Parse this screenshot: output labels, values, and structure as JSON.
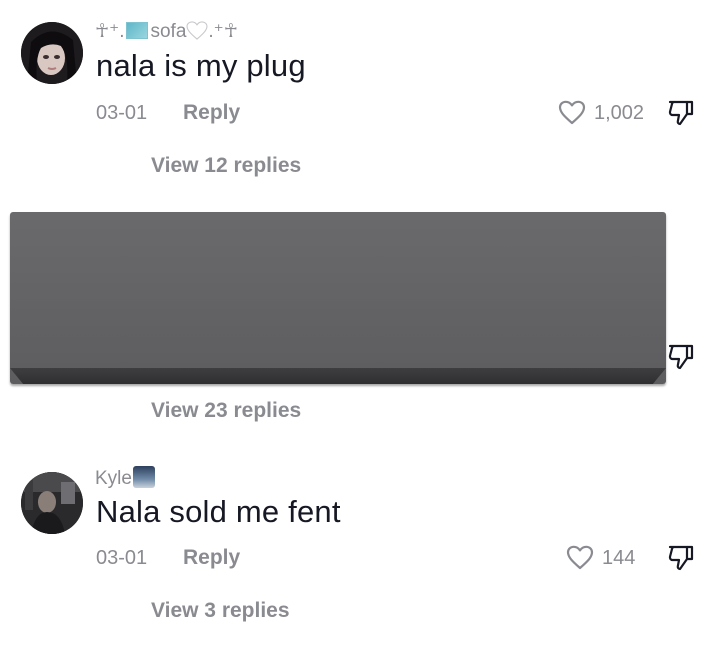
{
  "comments": [
    {
      "username_pre": "☥⁺.",
      "username": "sofa",
      "username_post": ".⁺☥",
      "text": "nala is my plug",
      "date": "03-01",
      "reply_label": "Reply",
      "likes": "1,002",
      "view_replies": "View 12 replies"
    },
    {
      "view_replies": "View 23 replies"
    },
    {
      "username": "Kyle",
      "text": "Nala sold me fent",
      "date": "03-01",
      "reply_label": "Reply",
      "likes": "144",
      "view_replies": "View 3 replies"
    }
  ],
  "icons": {
    "like": "heart-outline-icon",
    "dislike": "thumbs-down-icon",
    "username_flag": "flag-emoji-icon",
    "username_heart": "white-heart-emoji-icon",
    "username_scene": "city-night-emoji-icon"
  },
  "colors": {
    "text": "#161823",
    "muted": "#8a8b91",
    "redaction": "#626264"
  }
}
